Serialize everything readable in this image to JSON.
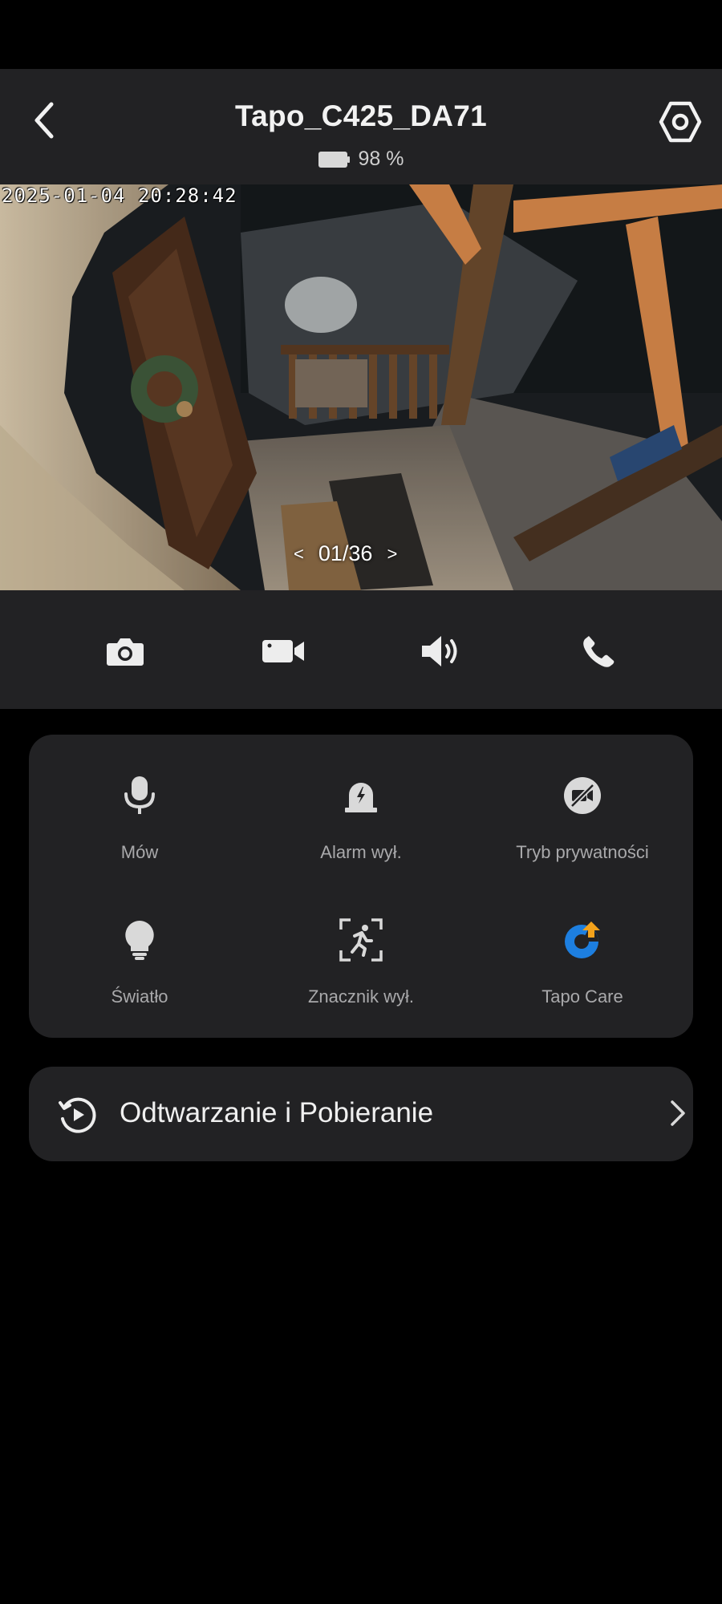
{
  "header": {
    "title": "Tapo_C425_DA71",
    "battery": "98 %"
  },
  "video": {
    "timestamp": "2025-01-04 20:28:42",
    "pager": "01/36",
    "prev_glyph": "<",
    "next_glyph": ">"
  },
  "controls": {
    "icons": [
      "camera-icon",
      "video-camera-icon",
      "speaker-icon",
      "phone-icon"
    ]
  },
  "features": {
    "items": [
      {
        "label": "Mów",
        "icon": "microphone-icon"
      },
      {
        "label": "Alarm wył.",
        "icon": "alarm-siren-icon"
      },
      {
        "label": "Tryb prywatności",
        "icon": "privacy-mode-icon"
      },
      {
        "label": "Światło",
        "icon": "light-bulb-icon"
      },
      {
        "label": "Znacznik wył.",
        "icon": "motion-marker-icon"
      },
      {
        "label": "Tapo Care",
        "icon": "tapo-care-icon"
      }
    ]
  },
  "playback": {
    "label": "Odtwarzanie i Pobieranie"
  },
  "colors": {
    "background": "#000000",
    "panel": "#222224",
    "text_primary": "#f0f0f0",
    "text_secondary": "#a9a9ab",
    "tapo_care_blue": "#1d7fe0",
    "tapo_care_orange": "#f3a21b"
  }
}
